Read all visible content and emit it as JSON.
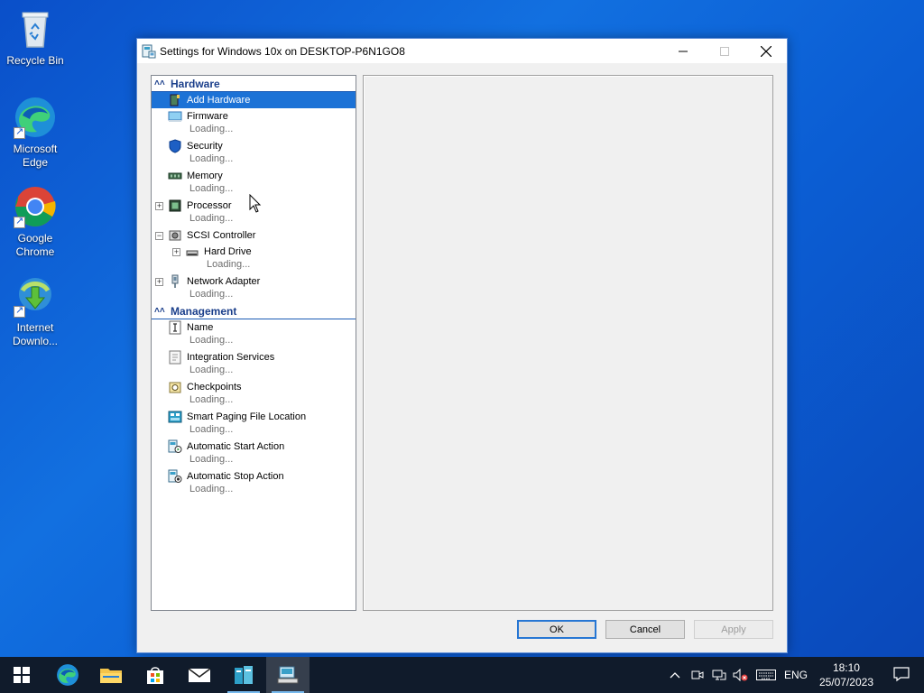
{
  "desktop": {
    "icons": [
      {
        "label": "Recycle Bin"
      },
      {
        "label": "Microsoft\nEdge"
      },
      {
        "label": "Google\nChrome"
      },
      {
        "label": "Internet\nDownlo..."
      }
    ]
  },
  "window": {
    "title": "Settings for Windows 10x on DESKTOP-P6N1GO8",
    "tree": {
      "hardware_header": "Hardware",
      "management_header": "Management",
      "hardware_items": [
        {
          "label": "Add Hardware",
          "sub": ""
        },
        {
          "label": "Firmware",
          "sub": "Loading..."
        },
        {
          "label": "Security",
          "sub": "Loading..."
        },
        {
          "label": "Memory",
          "sub": "Loading..."
        },
        {
          "label": "Processor",
          "sub": "Loading..."
        },
        {
          "label": "SCSI Controller",
          "sub": ""
        },
        {
          "label": "Hard Drive",
          "sub": "Loading..."
        },
        {
          "label": "Network Adapter",
          "sub": "Loading..."
        }
      ],
      "management_items": [
        {
          "label": "Name",
          "sub": "Loading..."
        },
        {
          "label": "Integration Services",
          "sub": "Loading..."
        },
        {
          "label": "Checkpoints",
          "sub": "Loading..."
        },
        {
          "label": "Smart Paging File Location",
          "sub": "Loading..."
        },
        {
          "label": "Automatic Start Action",
          "sub": "Loading..."
        },
        {
          "label": "Automatic Stop Action",
          "sub": "Loading..."
        }
      ]
    },
    "buttons": {
      "ok": "OK",
      "cancel": "Cancel",
      "apply": "Apply"
    }
  },
  "taskbar": {
    "language": "ENG",
    "time": "18:10",
    "date": "25/07/2023",
    "accent": "#1c72d6"
  }
}
